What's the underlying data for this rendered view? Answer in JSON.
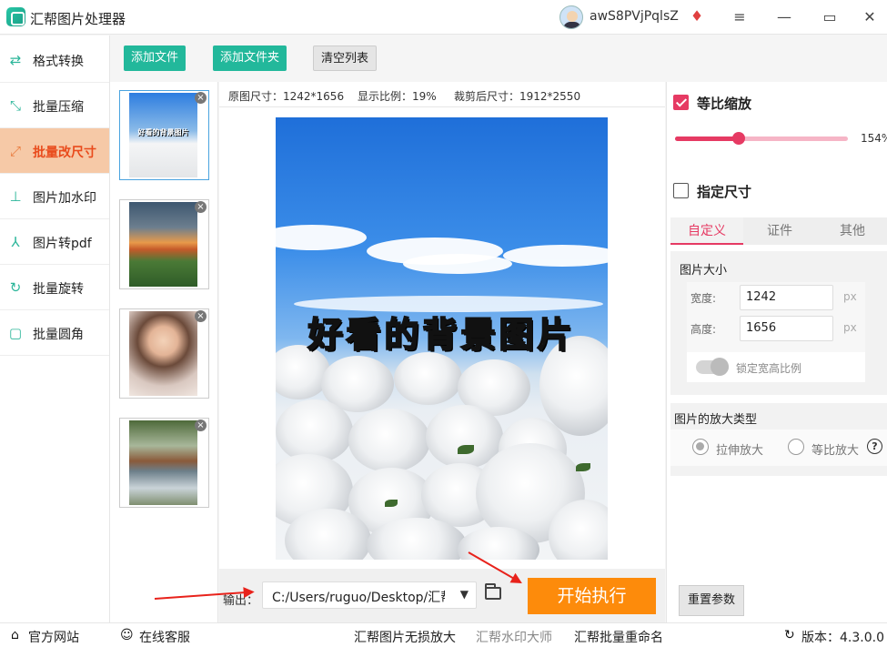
{
  "app": {
    "title": "汇帮图片处理器",
    "username": "awS8PVjPqlsZ"
  },
  "window_controls": {
    "menu": "≡",
    "minimize": "—",
    "maximize": "▭",
    "close": "✕"
  },
  "sidebar": {
    "items": [
      {
        "label": "格式转换",
        "icon": "convert-icon"
      },
      {
        "label": "批量压缩",
        "icon": "compress-icon"
      },
      {
        "label": "批量改尺寸",
        "icon": "resize-icon",
        "active": true
      },
      {
        "label": "图片加水印",
        "icon": "watermark-icon"
      },
      {
        "label": "图片转pdf",
        "icon": "pdf-icon"
      },
      {
        "label": "批量旋转",
        "icon": "rotate-icon"
      },
      {
        "label": "批量圆角",
        "icon": "round-corner-icon"
      }
    ]
  },
  "toolbar": {
    "add_file": "添加文件",
    "add_folder": "添加文件夹",
    "clear_list": "清空列表"
  },
  "thumbnails": {
    "first_caption": "好看的背景图片"
  },
  "info": {
    "original_size": "原图尺寸：1242*1656",
    "display_ratio": "显示比例：19%",
    "cropped_size": "裁剪后尺寸：1912*2550"
  },
  "preview": {
    "overlay_text": "好看的背景图片"
  },
  "output": {
    "label": "输出：",
    "path": "C:/Users/ruguo/Desktop/汇帮",
    "start_button": "开始执行"
  },
  "right_panel": {
    "proportional": {
      "label": "等比缩放",
      "checked": true,
      "value_text": "154%",
      "fraction": 0.37
    },
    "specify_size": {
      "label": "指定尺寸",
      "checked": false
    },
    "tabs": [
      "自定义",
      "证件",
      "其他"
    ],
    "image_size": {
      "title": "图片大小",
      "width_label": "宽度:",
      "width_value": "1242",
      "height_label": "高度:",
      "height_value": "1656",
      "unit": "px",
      "lock_label": "锁定宽高比例"
    },
    "enlarge": {
      "title": "图片的放大类型",
      "option_stretch": "拉伸放大",
      "option_proportional": "等比放大"
    },
    "reset_button": "重置参数"
  },
  "footer": {
    "website": "官方网站",
    "support": "在线客服",
    "link1": "汇帮图片无损放大",
    "link2": "汇帮水印大师",
    "link3": "汇帮批量重命名",
    "version": "版本：4.3.0.0"
  },
  "colors": {
    "accent_green": "#22b89b",
    "accent_pink": "#e63a63",
    "start_orange": "#fd8b0b",
    "active_bg": "#f6c9a7"
  }
}
